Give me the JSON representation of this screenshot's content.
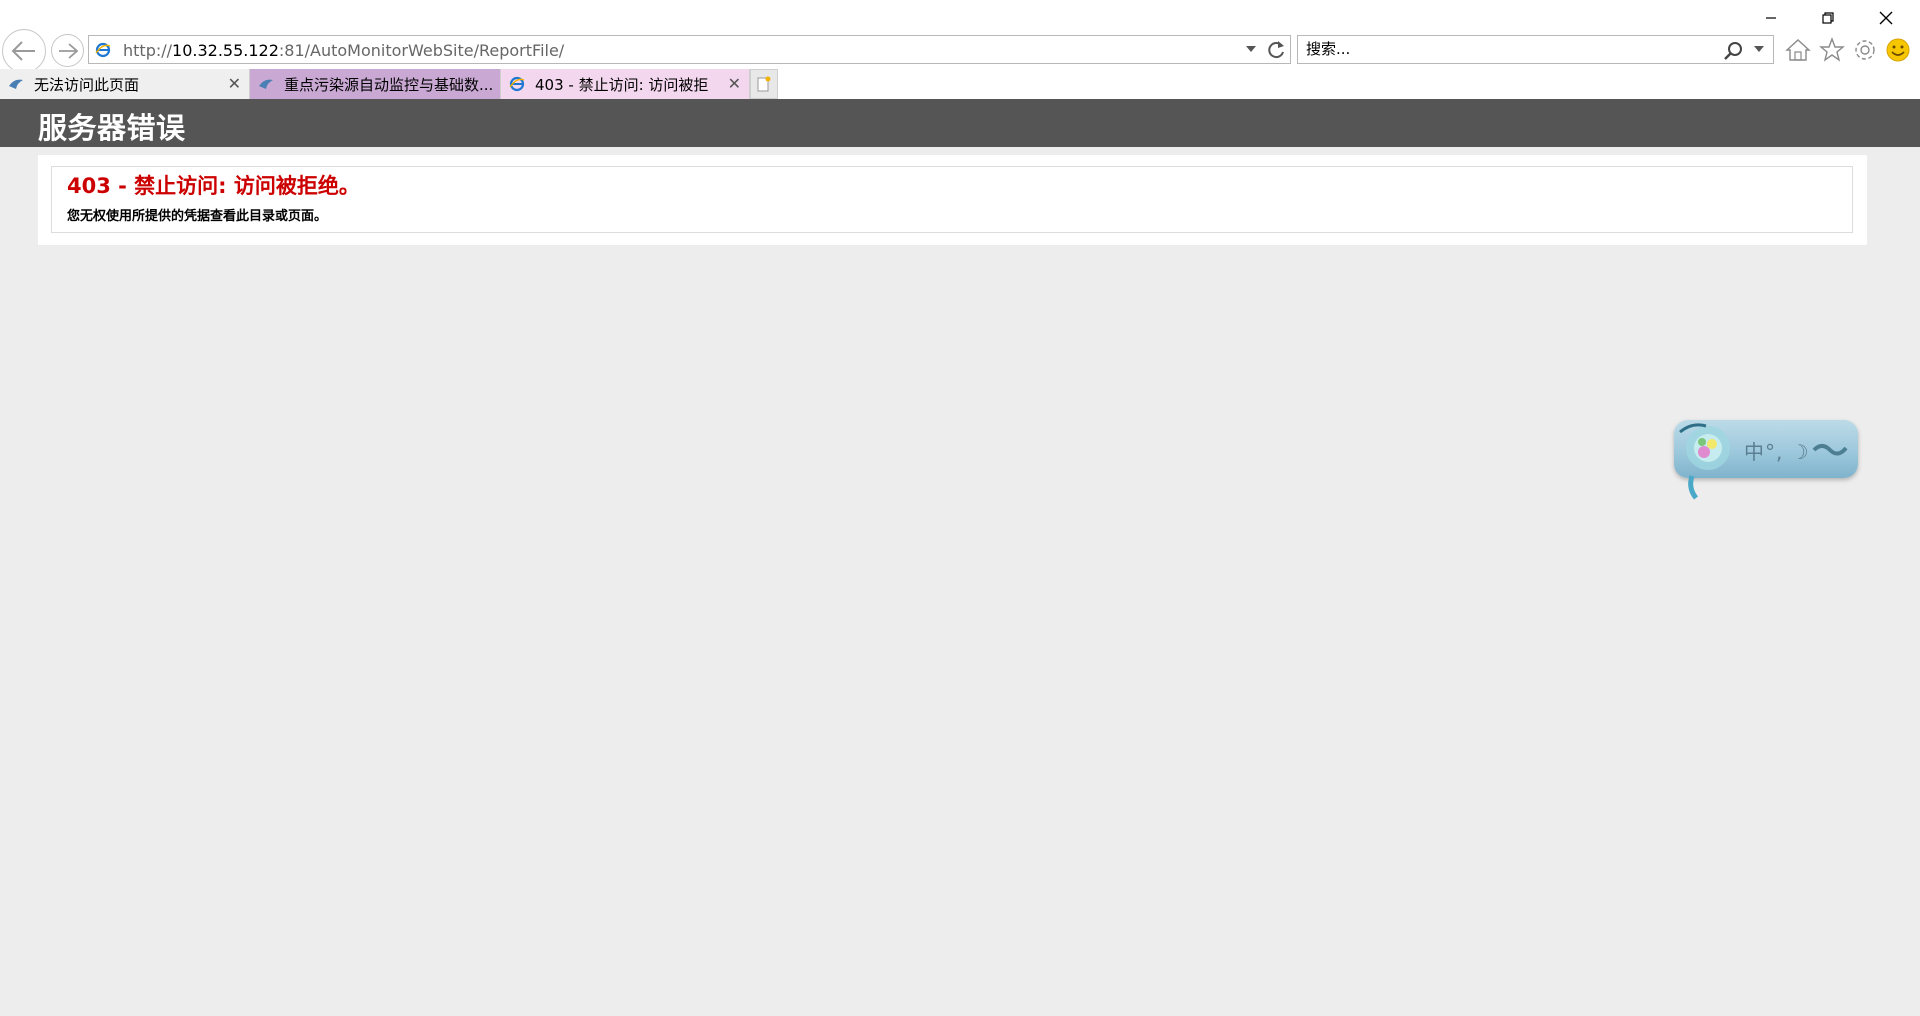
{
  "window": {
    "minimize_label": "minimize",
    "restore_label": "restore",
    "close_label": "close"
  },
  "address_bar": {
    "url_prefix": "http://",
    "url_host": "10.32.55.122",
    "url_rest": ":81/AutoMonitorWebSite/ReportFile/"
  },
  "search": {
    "placeholder": "搜索..."
  },
  "tabs": [
    {
      "label": "无法访问此页面",
      "has_close": true,
      "active": false
    },
    {
      "label": "重点污染源自动监控与基础数...",
      "has_close": false,
      "active": false
    },
    {
      "label": "403 - 禁止访问: 访问被拒",
      "has_close": true,
      "active": true
    }
  ],
  "page": {
    "heading": "服务器错误",
    "error_title": "403 - 禁止访问: 访问被拒绝。",
    "error_description": "您无权使用所提供的凭据查看此目录或页面。"
  },
  "ime": {
    "status_text": "中°, ☽"
  },
  "colors": {
    "header_band": "#555555",
    "error_title": "#cc0000",
    "page_background": "#ededed",
    "tab_2_background": "#c9a9d3",
    "tab_3_background": "#f3d7ee"
  },
  "icons": {
    "back": "back-arrow-icon",
    "forward": "forward-arrow-icon",
    "refresh": "refresh-icon",
    "search": "search-icon",
    "home": "home-icon",
    "favorites": "star-icon",
    "tools": "gear-icon",
    "feedback": "smiley-icon"
  }
}
